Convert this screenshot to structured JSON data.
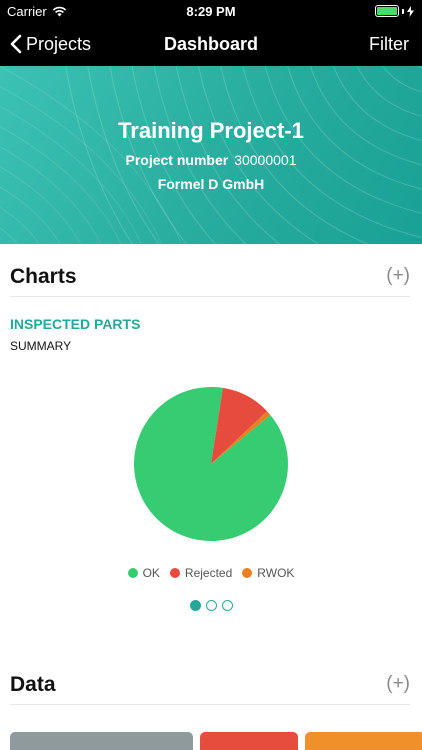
{
  "status_bar": {
    "carrier": "Carrier",
    "time": "8:29 PM"
  },
  "nav": {
    "back_label": "Projects",
    "title": "Dashboard",
    "filter_label": "Filter"
  },
  "project": {
    "name": "Training Project-1",
    "number_label": "Project number",
    "number": "30000001",
    "company": "Formel D GmbH"
  },
  "charts_section": {
    "title": "Charts",
    "add_label": "(+)"
  },
  "chart_card": {
    "title": "INSPECTED PARTS",
    "subtitle": "SUMMARY"
  },
  "chart_data": {
    "type": "pie",
    "categories": [
      "OK",
      "Rejected",
      "RWOK"
    ],
    "values": [
      88.5,
      10.5,
      1.0
    ],
    "colors": [
      "#37cc72",
      "#e64b3d",
      "#e8801f"
    ],
    "legend": "bottom"
  },
  "pager": {
    "count": 3,
    "active_index": 0
  },
  "data_section": {
    "title": "Data",
    "add_label": "(+)"
  },
  "data_tiles": {
    "colors": [
      "#8e9a9b",
      "#e74d3c",
      "#f0902a"
    ]
  },
  "colors": {
    "accent": "#24a89a",
    "bar_background": "#000000",
    "battery": "#4cd964"
  }
}
